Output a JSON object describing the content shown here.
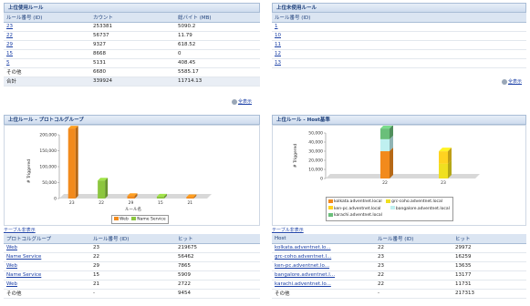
{
  "top_left": {
    "title": "上位使用ルール",
    "headers": [
      "ルール番号 (ID)",
      "カウント",
      "総バイト (MB)"
    ],
    "rows": [
      {
        "id": "23",
        "count": "253381",
        "bytes": "5090.2",
        "link": true
      },
      {
        "id": "22",
        "count": "56737",
        "bytes": "11.79",
        "link": true
      },
      {
        "id": "29",
        "count": "9327",
        "bytes": "618.52",
        "link": true
      },
      {
        "id": "15",
        "count": "8668",
        "bytes": "0",
        "link": true
      },
      {
        "id": "5",
        "count": "5131",
        "bytes": "408.45",
        "link": true
      },
      {
        "id": "その他",
        "count": "6680",
        "bytes": "5585.17",
        "link": false
      }
    ],
    "total": {
      "id": "合計",
      "count": "339924",
      "bytes": "11714.13"
    },
    "show_all": "全表示"
  },
  "top_right": {
    "title": "上位未使用ルール",
    "headers": [
      "ルール番号 (ID)"
    ],
    "rows": [
      "1",
      "10",
      "11",
      "12",
      "13"
    ],
    "show_all": "全表示"
  },
  "mid_left": {
    "title": "上位ルール - プロトコルグループ",
    "ylabel": "# Triggered",
    "xlabel": "ルール名",
    "table_link": "テーブル非表示",
    "headers": [
      "プロトコルグループ",
      "ルール番号 (ID)",
      "ヒット"
    ],
    "rows": [
      {
        "group": "Web",
        "id": "23",
        "hits": "219675"
      },
      {
        "group": "Name Service",
        "id": "22",
        "hits": "56462"
      },
      {
        "group": "Web",
        "id": "29",
        "hits": "7865"
      },
      {
        "group": "Name Service",
        "id": "15",
        "hits": "5909"
      },
      {
        "group": "Web",
        "id": "21",
        "hits": "2722"
      },
      {
        "group": "その他",
        "id": "-",
        "hits": "9454"
      }
    ]
  },
  "mid_right": {
    "title": "上位ルール - Host基準",
    "ylabel": "# Triggered",
    "table_link": "テーブル非表示",
    "headers": [
      "Host",
      "ルール番号 (ID)",
      "ヒット"
    ],
    "rows": [
      {
        "host": "kolkata.adventnet.lo...",
        "id": "22",
        "hits": "29972"
      },
      {
        "host": "grc-coho.adventnet.l...",
        "id": "23",
        "hits": "16259"
      },
      {
        "host": "ken-pc.adventnet.lo...",
        "id": "23",
        "hits": "13635"
      },
      {
        "host": "bangalore.adventnet.l...",
        "id": "22",
        "hits": "13177"
      },
      {
        "host": "karachi.adventnet.lo...",
        "id": "22",
        "hits": "11731"
      },
      {
        "host": "その他",
        "id": "-",
        "hits": "217313"
      }
    ]
  },
  "chart_data": [
    {
      "type": "bar",
      "title": "上位ルール - プロトコルグループ",
      "xlabel": "ルール名",
      "ylabel": "# Triggered",
      "categories": [
        "23",
        "22",
        "29",
        "15",
        "21"
      ],
      "series": [
        {
          "name": "Web",
          "values": [
            219675,
            0,
            7865,
            0,
            2722
          ],
          "color": "#f28a1c"
        },
        {
          "name": "Name Service",
          "values": [
            0,
            56462,
            0,
            5909,
            0
          ],
          "color": "#8cc63f"
        }
      ],
      "ylim": [
        0,
        200000
      ],
      "yticks": [
        "0",
        "50,000",
        "100,000",
        "150,000",
        "200,000"
      ],
      "legend": "bottom"
    },
    {
      "type": "bar",
      "title": "上位ルール - Host基準",
      "ylabel": "# Triggered",
      "categories": [
        "22",
        "23"
      ],
      "stacked": true,
      "series": [
        {
          "name": "kolkata.adventnet.local",
          "values": [
            29972,
            0
          ],
          "color": "#f28a1c"
        },
        {
          "name": "grc-coho.adventnet.local",
          "values": [
            0,
            16259
          ],
          "color": "#f0e020"
        },
        {
          "name": "ken-pc.adventnet.local",
          "values": [
            0,
            13635
          ],
          "color": "#ffd320"
        },
        {
          "name": "bangalore.adventnet.local",
          "values": [
            13177,
            0
          ],
          "color": "#bff0f0"
        },
        {
          "name": "karachi.adventnet.local",
          "values": [
            11731,
            0
          ],
          "color": "#6abf7a"
        }
      ],
      "ylim": [
        0,
        50000
      ],
      "yticks": [
        "0",
        "10,000",
        "20,000",
        "30,000",
        "40,000",
        "50,000"
      ],
      "legend": "bottom"
    }
  ]
}
